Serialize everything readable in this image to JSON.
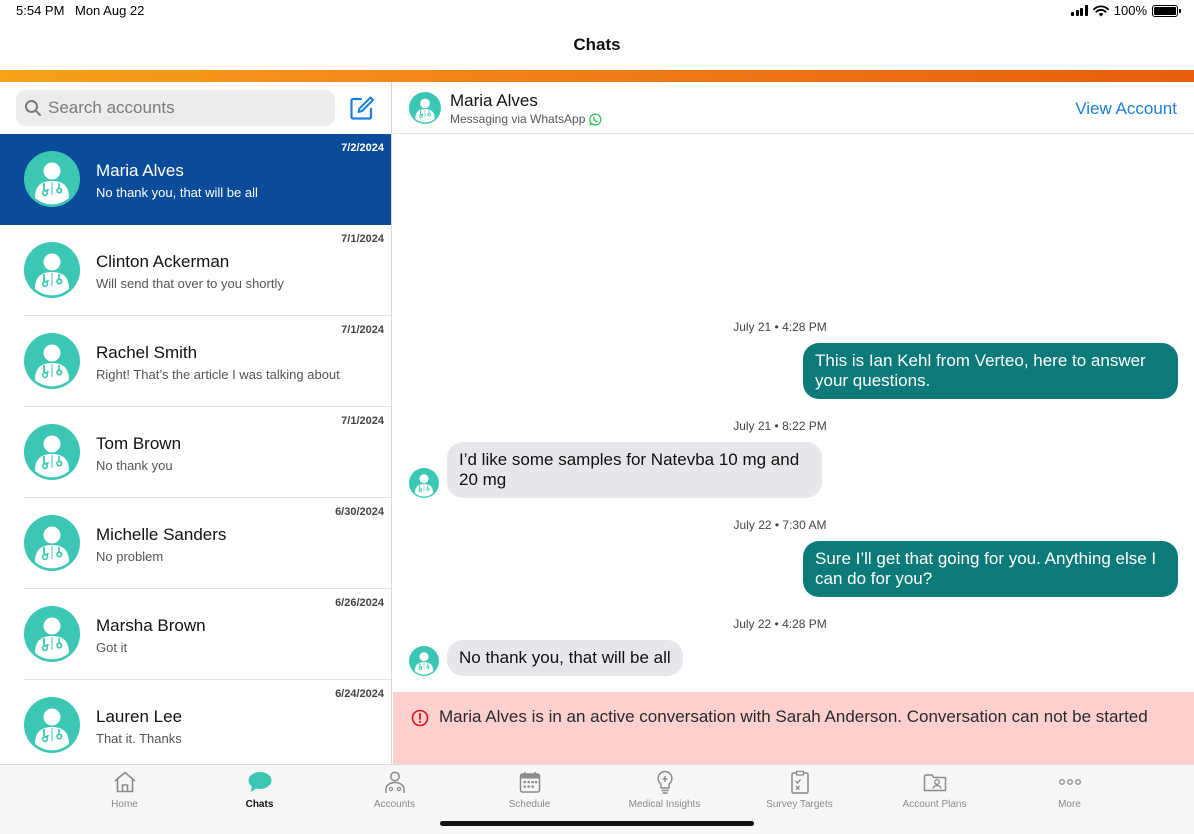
{
  "status": {
    "time": "5:54 PM",
    "date": "Mon Aug 22",
    "battery": "100%"
  },
  "nav": {
    "title": "Chats"
  },
  "search": {
    "placeholder": "Search accounts"
  },
  "chats": [
    {
      "name": "Maria Alves",
      "preview": "No thank you, that will be all",
      "date": "7/2/2024"
    },
    {
      "name": "Clinton Ackerman",
      "preview": "Will send that over to you shortly",
      "date": "7/1/2024"
    },
    {
      "name": "Rachel Smith",
      "preview": "Right! That’s the article I was talking about",
      "date": "7/1/2024"
    },
    {
      "name": "Tom Brown",
      "preview": "No thank you",
      "date": "7/1/2024"
    },
    {
      "name": "Michelle Sanders",
      "preview": "No problem",
      "date": "6/30/2024"
    },
    {
      "name": "Marsha Brown",
      "preview": "Got it",
      "date": "6/26/2024"
    },
    {
      "name": "Lauren Lee",
      "preview": "That it. Thanks",
      "date": "6/24/2024"
    }
  ],
  "conversation": {
    "name": "Maria Alves",
    "channel": "Messaging via WhatsApp",
    "view_account": "View Account",
    "messages": [
      {
        "time": "July 21 • 4:28 PM",
        "text": "This is Ian Kehl from Verteo, here to answer your questions.",
        "direction": "out"
      },
      {
        "time": "July 21 • 8:22 PM",
        "text": "I’d like some samples for Natevba 10 mg and 20 mg",
        "direction": "in"
      },
      {
        "time": "July 22 • 7:30 AM",
        "text": "Sure I’ll get that going for you. Anything else I can do for you?",
        "direction": "out"
      },
      {
        "time": "July 22 • 4:28 PM",
        "text": "No thank you, that will be all",
        "direction": "in"
      }
    ],
    "alert": "Maria Alves is in an active conversation with Sarah Anderson. Conversation can not be started"
  },
  "tabs": [
    {
      "label": "Home",
      "icon": "home-icon"
    },
    {
      "label": "Chats",
      "icon": "chat-bubble-icon"
    },
    {
      "label": "Accounts",
      "icon": "doctor-icon"
    },
    {
      "label": "Schedule",
      "icon": "calendar-icon"
    },
    {
      "label": "Medical Insights",
      "icon": "lightbulb-icon"
    },
    {
      "label": "Survey Targets",
      "icon": "clipboard-icon"
    },
    {
      "label": "Account Plans",
      "icon": "folder-person-icon"
    },
    {
      "label": "More",
      "icon": "more-dots-icon"
    }
  ],
  "colors": {
    "accent_start": "#f7a21b",
    "accent_end": "#e85d0f",
    "active_row": "#0a4c99",
    "outgoing_bubble": "#0b7a78",
    "incoming_bubble": "#e6e6eb",
    "avatar": "#3cc7b4",
    "alert_bg": "#fdd0d0",
    "link": "#1a7fe0"
  }
}
